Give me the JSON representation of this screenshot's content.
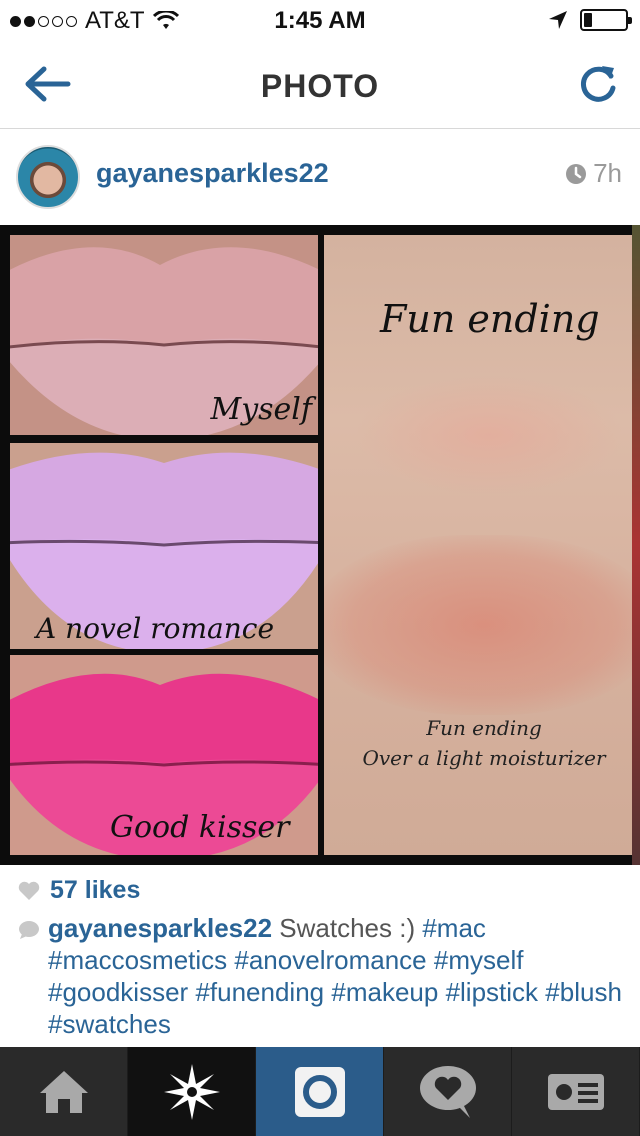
{
  "status_bar": {
    "signal_dots_filled": 2,
    "signal_dots_total": 5,
    "carrier": "AT&T",
    "time": "1:45 AM",
    "icons": [
      "wifi-icon",
      "location-arrow-icon",
      "battery-icon"
    ]
  },
  "navbar": {
    "title": "PHOTO",
    "back_icon": "back-arrow-icon",
    "refresh_icon": "refresh-icon"
  },
  "post": {
    "username": "gayanesparkles22",
    "time_ago": "7h",
    "photo": {
      "panel_captions": [
        "Myself",
        "A novel romance",
        "Good kisser"
      ],
      "arm_title": "Fun ending",
      "arm_note_line1": "Fun ending",
      "arm_note_line2": "Over a light moisturizer"
    },
    "likes": "57 likes",
    "caption": {
      "username": "gayanesparkles22",
      "text": "Swatches :)",
      "hashtags": [
        "#mac",
        "#maccosmetics",
        "#anovelromance",
        "#myself",
        "#goodkisser",
        "#funending",
        "#makeup",
        "#lipstick",
        "#blush",
        "#swatches"
      ]
    }
  },
  "tabbar": {
    "tabs": [
      {
        "name": "home",
        "icon": "home-icon"
      },
      {
        "name": "explore",
        "icon": "explore-star-icon"
      },
      {
        "name": "camera",
        "icon": "camera-icon"
      },
      {
        "name": "activity",
        "icon": "heart-bubble-icon"
      },
      {
        "name": "profile",
        "icon": "profile-card-icon"
      }
    ]
  },
  "colors": {
    "link_blue": "#2a6496",
    "tab_bar": "#2a2a2a",
    "camera_tab": "#2b5c8a",
    "lip_myself": "#e8aab0",
    "lip_novel_romance": "#d7a6e6",
    "lip_good_kisser": "#e8388a"
  }
}
